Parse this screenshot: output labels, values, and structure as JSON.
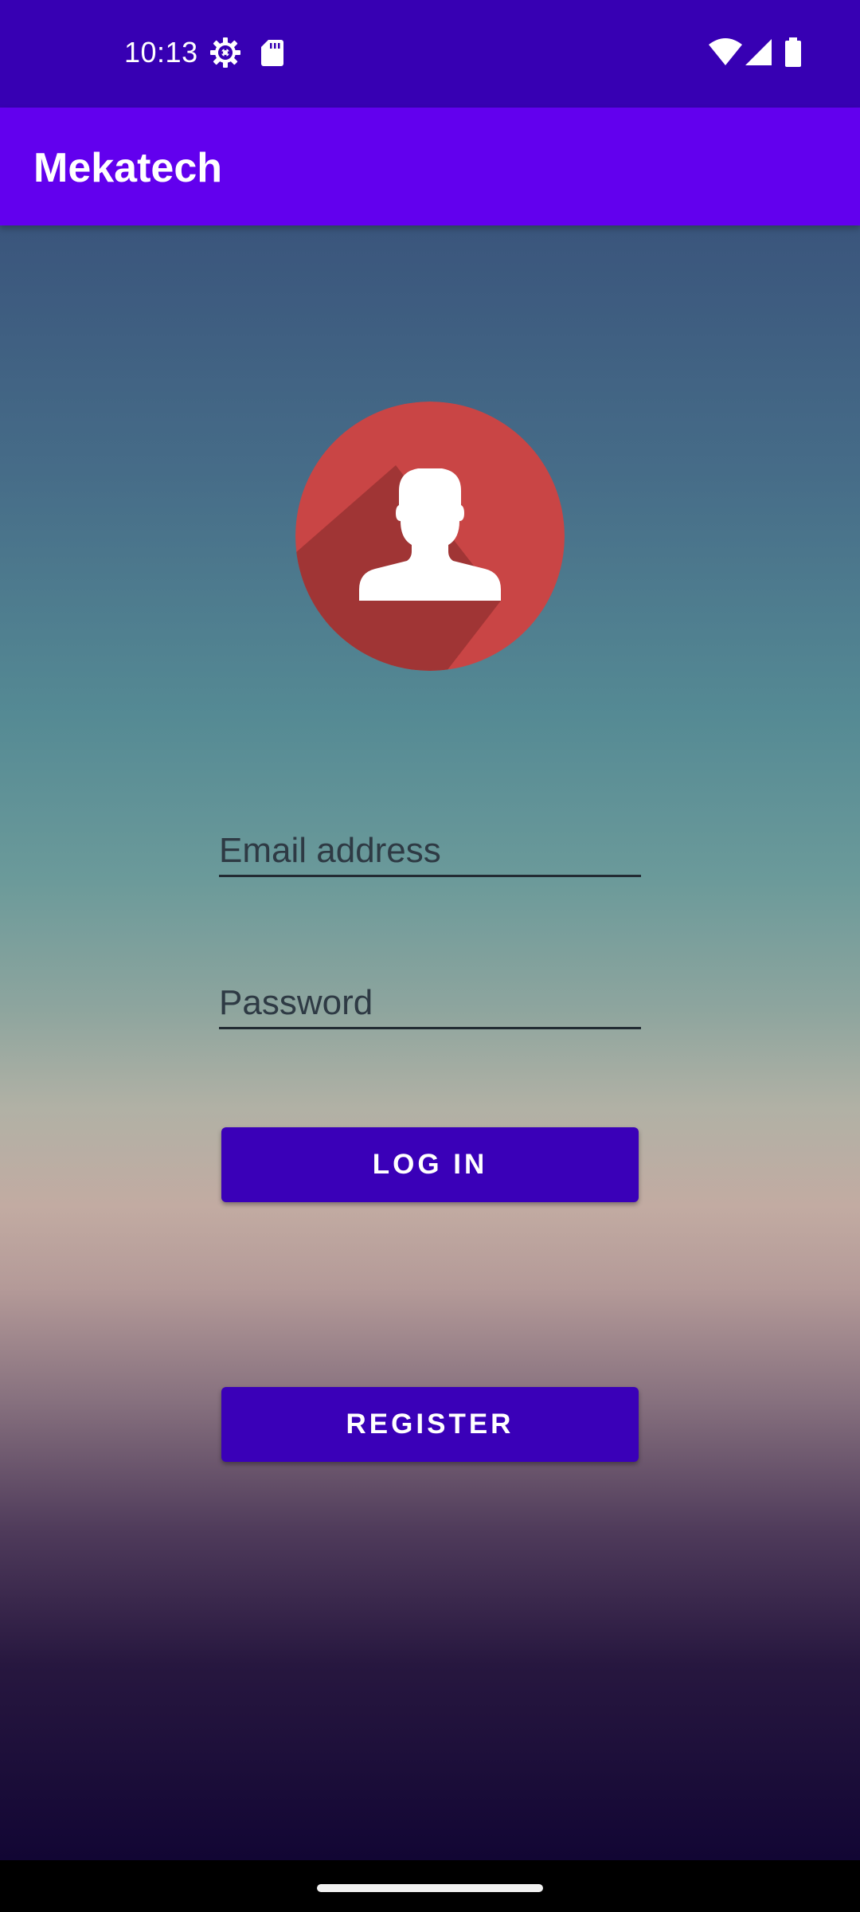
{
  "status_bar": {
    "time": "10:13",
    "icons": [
      "settings-gear-icon",
      "sd-card-icon",
      "wifi-icon",
      "cell-signal-icon",
      "battery-icon"
    ]
  },
  "app_bar": {
    "title": "Mekatech"
  },
  "login_form": {
    "avatar_icon": "user-avatar-icon",
    "email_placeholder": "Email address",
    "email_value": "",
    "password_placeholder": "Password",
    "password_value": "",
    "login_label": "LOG IN",
    "register_label": "REGISTER"
  },
  "colors": {
    "status_bar": "#3700b3",
    "app_bar": "#6200ee",
    "button": "#3a00b8",
    "avatar_circle": "#c94545",
    "avatar_shadow": "#a03535"
  }
}
